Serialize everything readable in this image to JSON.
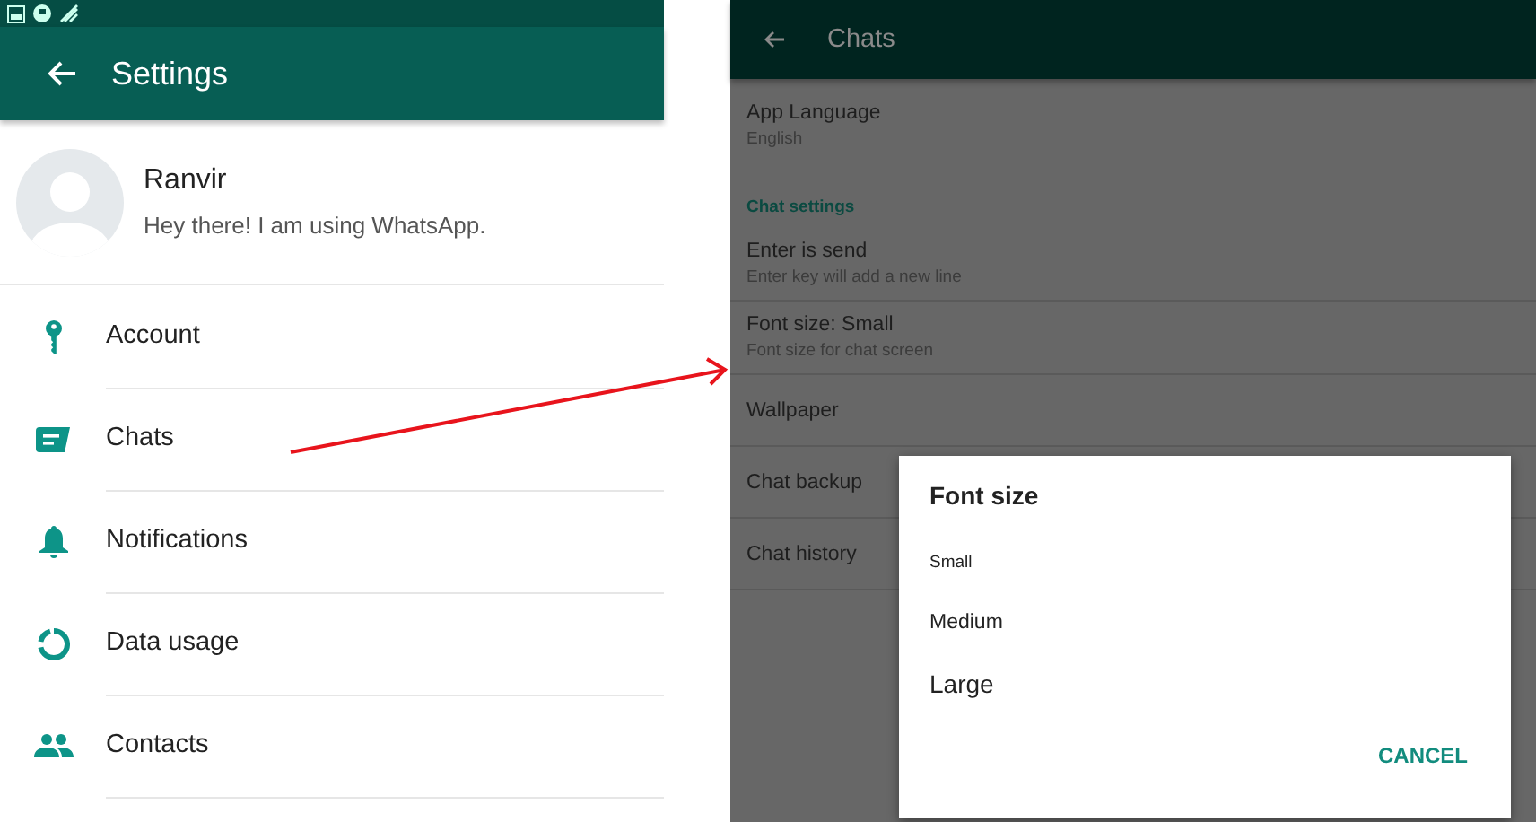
{
  "settings_screen": {
    "title": "Settings",
    "profile": {
      "name": "Ranvir",
      "status": "Hey there! I am using WhatsApp."
    },
    "items": [
      {
        "label": "Account"
      },
      {
        "label": "Chats"
      },
      {
        "label": "Notifications"
      },
      {
        "label": "Data usage"
      },
      {
        "label": "Contacts"
      }
    ]
  },
  "chats_screen": {
    "title": "Chats",
    "rows": [
      {
        "kind": "setting",
        "title": "App Language",
        "subtitle": "English"
      },
      {
        "kind": "header",
        "title": "Chat settings"
      },
      {
        "kind": "setting",
        "title": "Enter is send",
        "subtitle": "Enter key will add a new line"
      },
      {
        "kind": "setting",
        "title": "Font size: Small",
        "subtitle": "Font size for chat screen"
      },
      {
        "kind": "setting",
        "title": "Wallpaper"
      },
      {
        "kind": "setting",
        "title": "Chat backup"
      },
      {
        "kind": "setting",
        "title": "Chat history"
      }
    ],
    "dialog": {
      "title": "Font size",
      "options": [
        {
          "label": "Small",
          "kind": "small"
        },
        {
          "label": "Medium",
          "kind": "medium"
        },
        {
          "label": "Large",
          "kind": "large"
        }
      ],
      "button": "CANCEL"
    }
  }
}
